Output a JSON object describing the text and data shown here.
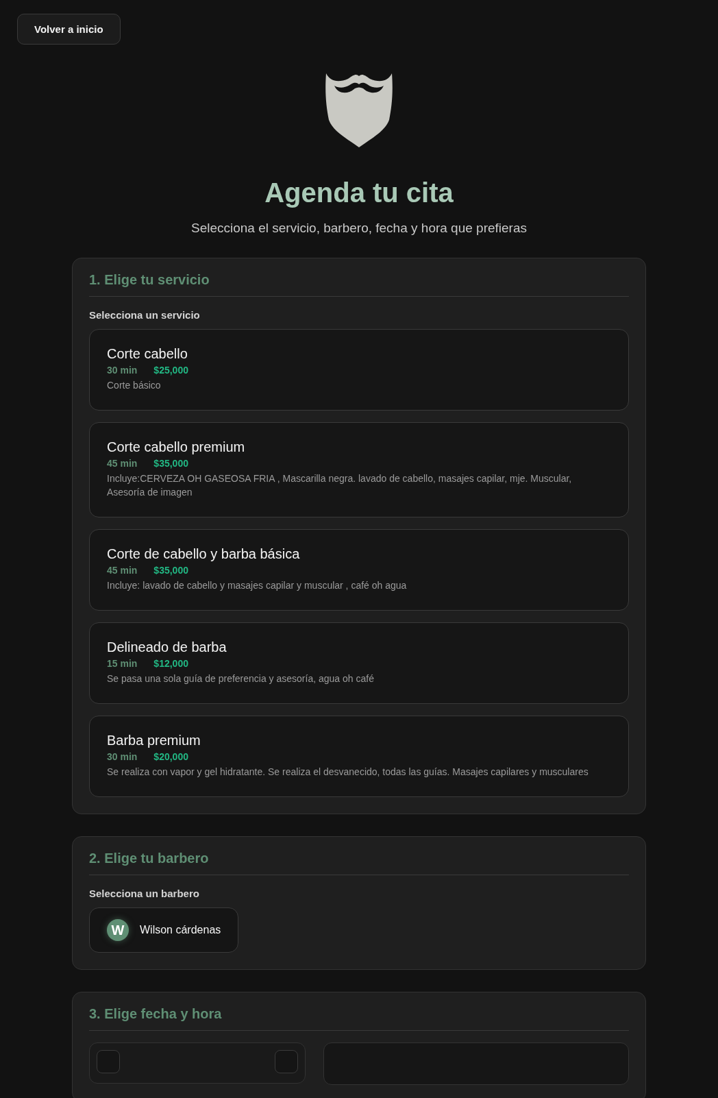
{
  "back_button": {
    "label": "Volver a inicio"
  },
  "header": {
    "title": "Agenda tu cita",
    "subtitle": "Selecciona el servicio, barbero, fecha y hora que prefieras"
  },
  "services_section": {
    "title": "1. Elige tu servicio",
    "label": "Selecciona un servicio",
    "services": [
      {
        "name": "Corte cabello",
        "duration": "30 min",
        "price": "$25,000",
        "description": "Corte básico",
        "selected": false
      },
      {
        "name": "Corte cabello premium",
        "duration": "45 min",
        "price": "$35,000",
        "description": "Incluye:CERVEZA OH GASEOSA FRIA , Mascarilla negra. lavado de cabello, masajes capilar, mje. Muscular, Asesoría de imagen",
        "selected": false
      },
      {
        "name": "Corte de cabello y barba básica",
        "duration": "45 min",
        "price": "$35,000",
        "description": "Incluye: lavado de cabello y masajes capilar y muscular , café oh agua",
        "selected": false
      },
      {
        "name": "Delineado de barba",
        "duration": "15 min",
        "price": "$12,000",
        "description": "Se pasa una sola guía de preferencia y asesoría, agua oh café",
        "selected": false
      },
      {
        "name": "Barba premium",
        "duration": "30 min",
        "price": "$20,000",
        "description": "Se realiza con vapor y gel hidratante. Se realiza el desvanecido, todas las guías. Masajes capilares y musculares",
        "selected": false
      }
    ]
  },
  "barber_section": {
    "title": "2. Elige tu barbero",
    "label": "Selecciona un barbero",
    "barbers": [
      {
        "initial": "W",
        "name": "Wilson cárdenas",
        "selected": false
      }
    ]
  },
  "datetime_section": {
    "title": "3. Elige fecha y hora"
  }
}
